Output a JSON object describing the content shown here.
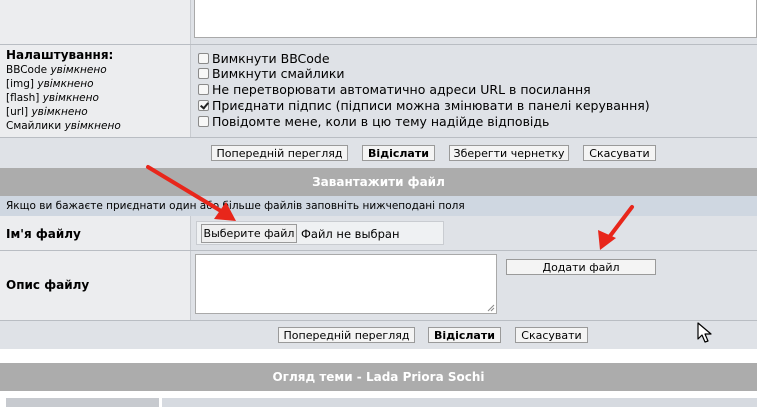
{
  "settings": {
    "title": "Налаштування:",
    "status_lines": [
      {
        "label": "BBCode",
        "state": "увімкнено"
      },
      {
        "label": "[img]",
        "state": "увімкнено"
      },
      {
        "label": "[flash]",
        "state": "увімкнено"
      },
      {
        "label": "[url]",
        "state": "увімкнено"
      },
      {
        "label": "Смайлики",
        "state": "увімкнено"
      }
    ],
    "options": [
      {
        "label": "Вимкнути BBCode",
        "checked": false
      },
      {
        "label": "Вимкнути смайлики",
        "checked": false
      },
      {
        "label": "Не перетворювати автоматично адреси URL в посилання",
        "checked": false
      },
      {
        "label": "Приєднати підпис (підписи можна змінювати в панелі керування)",
        "checked": true
      },
      {
        "label": "Повідомте мене, коли в цю тему надійде відповідь",
        "checked": false
      }
    ]
  },
  "post_buttons": {
    "preview": "Попередній перегляд",
    "submit": "Відіслати",
    "save_draft": "Зберегти чернетку",
    "cancel": "Скасувати"
  },
  "upload": {
    "header": "Завантажити файл",
    "hint": "Якщо ви бажаєте приєднати один або більше файлів заповніть нижчеподані поля",
    "filename_label": "Ім'я файлу",
    "choose_button": "Выберите файл",
    "no_file_text": "Файл не выбран",
    "description_label": "Опис файлу",
    "add_file_button": "Додати файл"
  },
  "bottom_buttons": {
    "preview": "Попередній перегляд",
    "submit": "Відіслати",
    "cancel": "Скасувати"
  },
  "review": {
    "header": "Огляд теми - Lada Priora Sochi"
  },
  "colors": {
    "header_bg": "#acacac",
    "row_left_bg": "#ecedef",
    "row_right_bg": "#dfe2e7",
    "arrow": "#e8261b"
  }
}
